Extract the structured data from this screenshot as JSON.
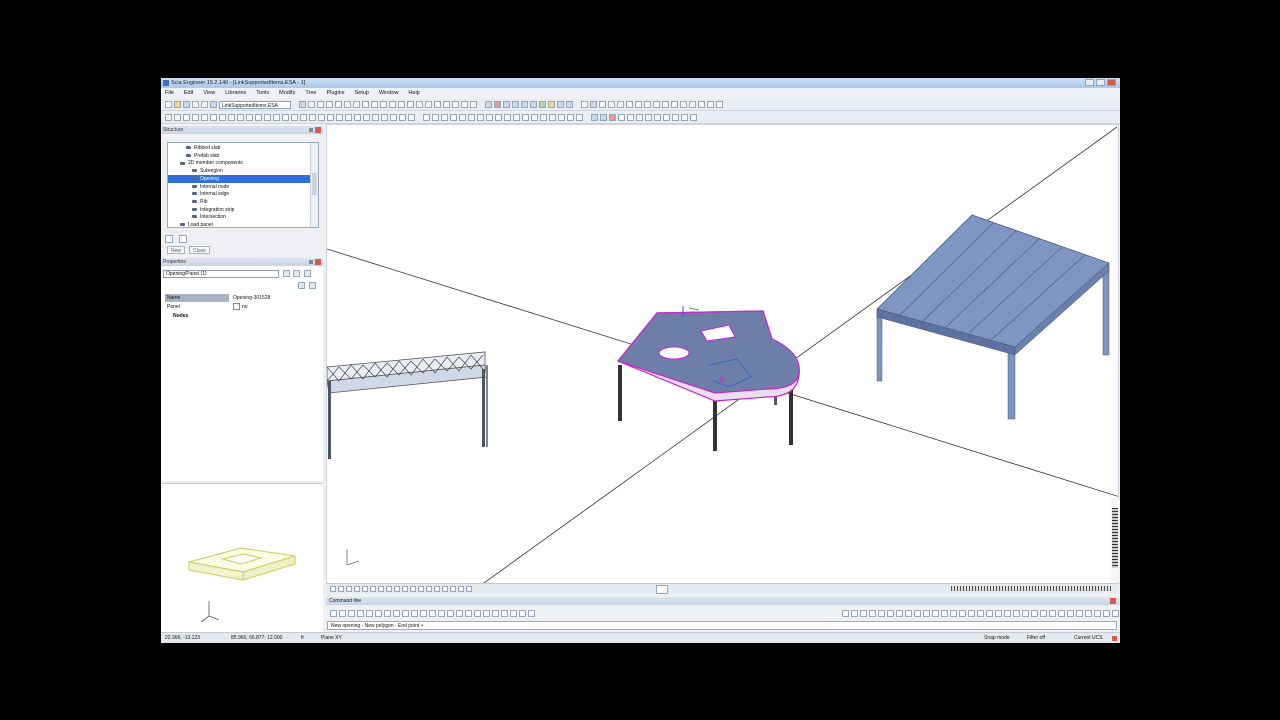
{
  "window": {
    "title": "Scia Engineer 15.2.140 - [LinkSupportedItems.ESA - 1]"
  },
  "menu": [
    "File",
    "Edit",
    "View",
    "Libraries",
    "Tools",
    "Modify",
    "Tree",
    "Plugins",
    "Setup",
    "Window",
    "Help"
  ],
  "toolbar": {
    "project_combo": "LinkSupportedItems.ESA"
  },
  "structure_panel": {
    "title": "Structure",
    "items": [
      {
        "label": "Ribbed slab",
        "indent": 2,
        "selected": false
      },
      {
        "label": "Prefab slab",
        "indent": 2,
        "selected": false
      },
      {
        "label": "2D member components",
        "indent": 1,
        "selected": false
      },
      {
        "label": "Subregion",
        "indent": 3,
        "selected": false
      },
      {
        "label": "Opening",
        "indent": 3,
        "selected": true
      },
      {
        "label": "Internal node",
        "indent": 3,
        "selected": false
      },
      {
        "label": "Internal edge",
        "indent": 3,
        "selected": false
      },
      {
        "label": "Rib",
        "indent": 3,
        "selected": false
      },
      {
        "label": "Integration strip",
        "indent": 3,
        "selected": false
      },
      {
        "label": "Intersection",
        "indent": 3,
        "selected": false
      },
      {
        "label": "Load panel",
        "indent": 1,
        "selected": false
      }
    ],
    "new_label": "New",
    "close_label": "Close"
  },
  "properties_panel": {
    "title": "Properties",
    "selector": "Opening/Panel (1)",
    "rows": [
      {
        "key": "Name",
        "value": "Opening-301528"
      },
      {
        "key": "Panel",
        "value": "no"
      }
    ],
    "section": "Nodes"
  },
  "command_line": {
    "title": "Command line",
    "prompt": "New opening - New polygon - End point >"
  },
  "status": {
    "coords1": "22.966; -13.123",
    "coords2": "85.966; 66.877; 12.000",
    "unit": "ft",
    "plane": "Plane XY",
    "snap": "Snap mode",
    "filter": "Filter off",
    "ucs": "Current UCS"
  },
  "colors": {
    "accent": "#2f6fd8",
    "selection": "#cc22cc",
    "structure": "#6d8bbf"
  }
}
